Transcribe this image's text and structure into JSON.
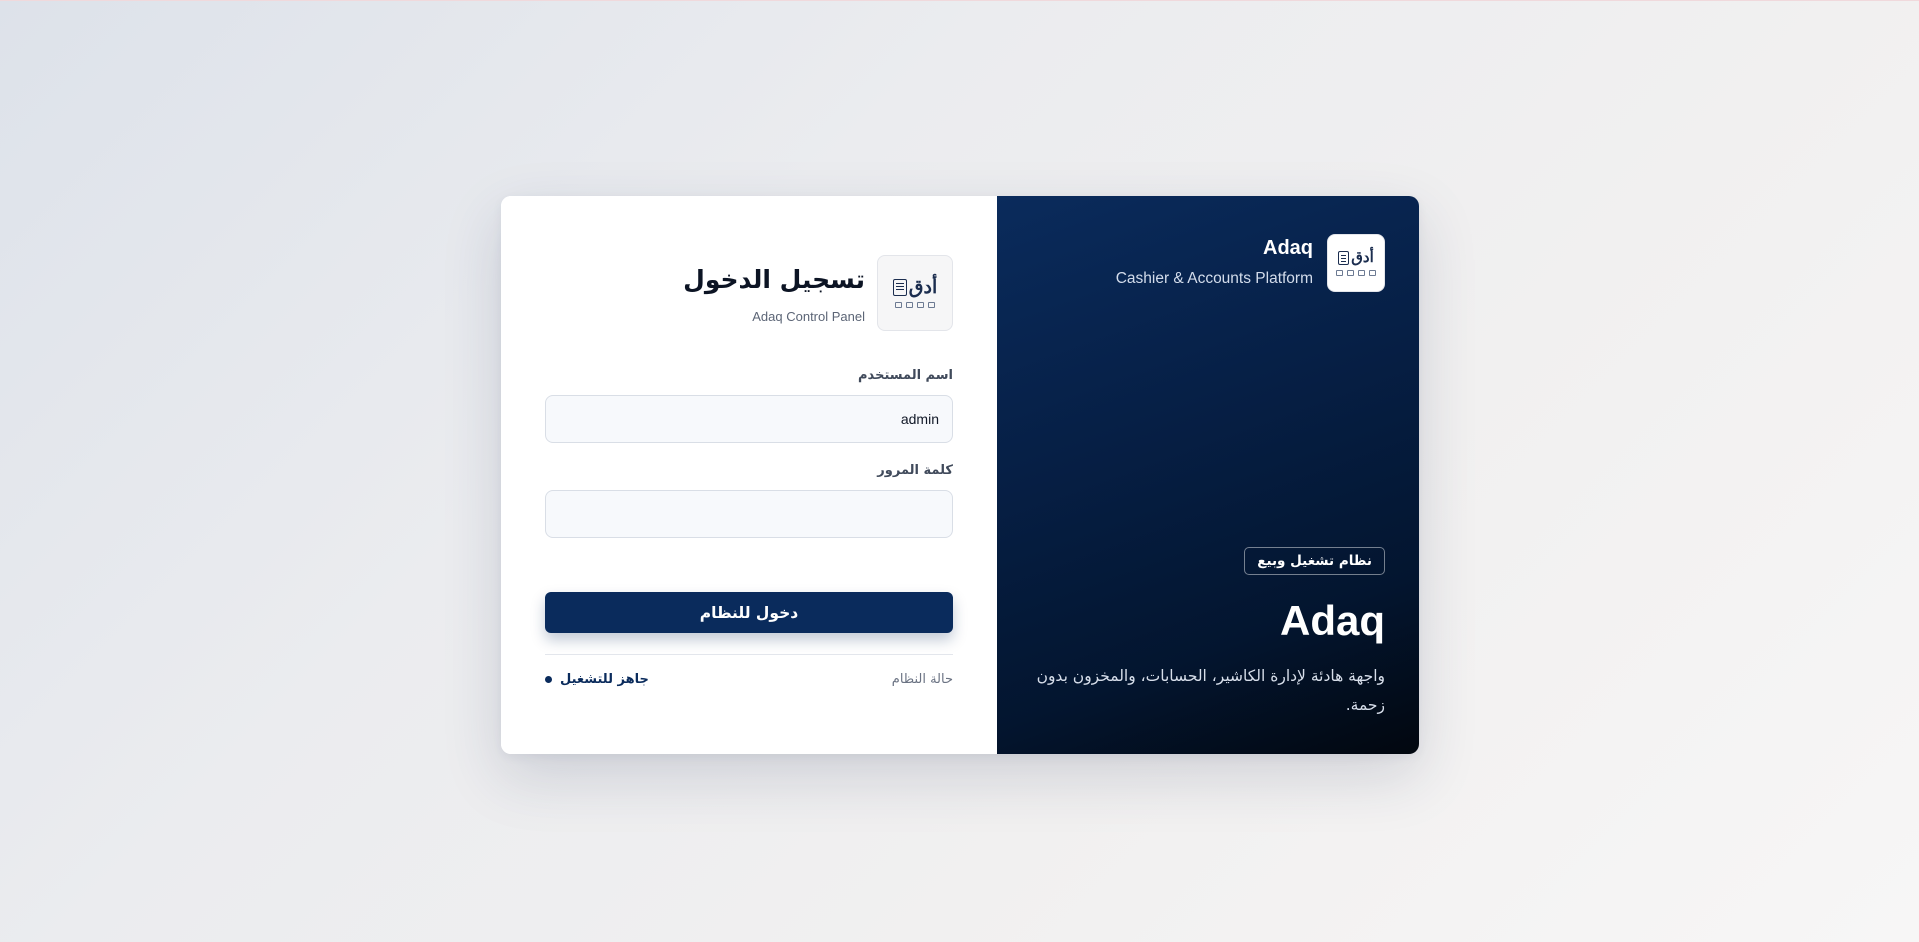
{
  "brand": {
    "logo_text": "أدق",
    "name": "Adaq",
    "subtitle": "Cashier & Accounts Platform",
    "badge": "نظام تشغيل وبيع",
    "hero_title": "Adaq",
    "description": "واجهة هادئة لإدارة الكاشير، الحسابات، والمخزون بدون زحمة."
  },
  "login": {
    "logo_text": "أدق",
    "title": "تسجيل الدخول",
    "subtitle": "Adaq Control Panel",
    "username_label": "اسم المستخدم",
    "username_value": "admin",
    "password_label": "كلمة المرور",
    "password_value": "",
    "submit_label": "دخول للنظام",
    "status_label": "حالة النظام",
    "status_value": "جاهز للتشغيل"
  },
  "colors": {
    "primary": "#0a2b5c",
    "panel_dark": "#02070f",
    "page_bg": "#ebecef"
  },
  "icons": {
    "logo": "adaq-logo-icon",
    "status": "status-dot-icon"
  }
}
